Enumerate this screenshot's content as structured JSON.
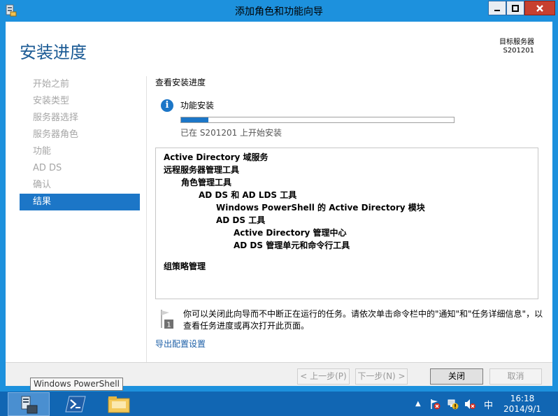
{
  "window": {
    "title": "添加角色和功能向导"
  },
  "header": {
    "page_title": "安装进度",
    "target_label": "目标服务器",
    "target_server": "S201201"
  },
  "nav": {
    "items": [
      {
        "label": "开始之前",
        "state": "disabled"
      },
      {
        "label": "安装类型",
        "state": "disabled"
      },
      {
        "label": "服务器选择",
        "state": "disabled"
      },
      {
        "label": "服务器角色",
        "state": "disabled"
      },
      {
        "label": "功能",
        "state": "disabled"
      },
      {
        "label": "AD DS",
        "state": "disabled"
      },
      {
        "label": "确认",
        "state": "disabled"
      },
      {
        "label": "结果",
        "state": "active"
      }
    ]
  },
  "main": {
    "section_heading": "查看安装进度",
    "status_label": "功能安装",
    "progress_fraction": 0.1,
    "progress_status": "已在 S201201 上开始安装",
    "results": [
      {
        "text": "Active Directory 域服务",
        "indent": 0
      },
      {
        "text": "远程服务器管理工具",
        "indent": 0
      },
      {
        "text": "角色管理工具",
        "indent": 1
      },
      {
        "text": "AD DS 和 AD LDS 工具",
        "indent": 2
      },
      {
        "text": "Windows PowerShell 的 Active Directory 模块",
        "indent": 3
      },
      {
        "text": "AD DS 工具",
        "indent": 3
      },
      {
        "text": "Active Directory 管理中心",
        "indent": 4
      },
      {
        "text": "AD DS 管理单元和命令行工具",
        "indent": 4
      },
      {
        "text": "",
        "indent": 0,
        "gap": true
      },
      {
        "text": "组策略管理",
        "indent": 0
      }
    ],
    "note_badge": "1",
    "note": "你可以关闭此向导而不中断正在运行的任务。请依次单击命令栏中的\"通知\"和\"任务详细信息\"，以查看任务进度或再次打开此页面。",
    "export_link": "导出配置设置"
  },
  "footer": {
    "prev": "< 上一步(P)",
    "next": "下一步(N) >",
    "close": "关闭",
    "cancel": "取消"
  },
  "tooltip": "Windows PowerShell",
  "taskbar": {
    "ime": "中",
    "time": "16:18",
    "date": "2014/9/1"
  }
}
